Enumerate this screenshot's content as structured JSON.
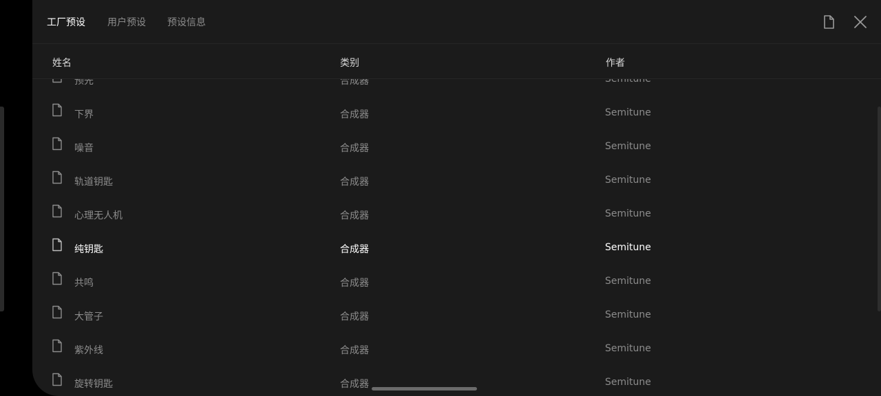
{
  "tabs": [
    {
      "label": "工厂预设",
      "active": true
    },
    {
      "label": "用户预设",
      "active": false
    },
    {
      "label": "预设信息",
      "active": false
    }
  ],
  "toolbar": {
    "file_icon": "document-icon",
    "close_icon": "close-icon"
  },
  "columns": {
    "name": "姓名",
    "category": "类别",
    "author": "作者"
  },
  "rows": [
    {
      "name": "预先",
      "category": "合成器",
      "author": "Semitune"
    },
    {
      "name": "下界",
      "category": "合成器",
      "author": "Semitune"
    },
    {
      "name": "噪音",
      "category": "合成器",
      "author": "Semitune"
    },
    {
      "name": "轨道钥匙",
      "category": "合成器",
      "author": "Semitune"
    },
    {
      "name": "心理无人机",
      "category": "合成器",
      "author": "Semitune"
    },
    {
      "name": "纯钥匙",
      "category": "合成器",
      "author": "Semitune",
      "selected": true
    },
    {
      "name": "共鸣",
      "category": "合成器",
      "author": "Semitune"
    },
    {
      "name": "大管子",
      "category": "合成器",
      "author": "Semitune"
    },
    {
      "name": "紫外线",
      "category": "合成器",
      "author": "Semitune"
    },
    {
      "name": "旋转钥匙",
      "category": "合成器",
      "author": "Semitune"
    }
  ],
  "colors": {
    "background": "#1b1b1b",
    "text_dim": "#8c8c8c",
    "text_active": "#ffffff"
  }
}
